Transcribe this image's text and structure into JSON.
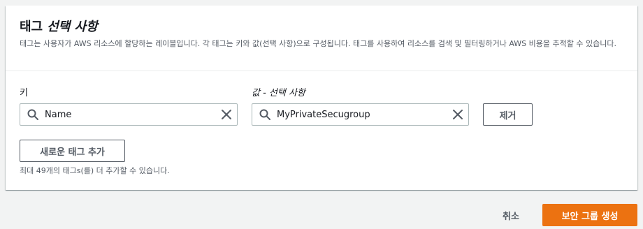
{
  "section": {
    "title": "태그",
    "title_optional": "선택 사항",
    "description": "태그는 사용자가 AWS 리소스에 할당하는 레이블입니다. 각 태그는 키와 값(선택 사항)으로 구성됩니다. 태그를 사용하여 리소스를 검색 및 필터링하거나 AWS 비용을 추적할 수 있습니다."
  },
  "tag_editor": {
    "key_label": "키",
    "value_label": "값 - 선택 사항",
    "rows": [
      {
        "key": "Name",
        "value": "MyPrivateSecugroup",
        "remove_label": "제거"
      }
    ],
    "add_label": "새로운 태그 추가",
    "limit_hint": "최대 49개의 태그s(를) 더 추가할 수 있습니다."
  },
  "footer": {
    "cancel_label": "취소",
    "submit_label": "보안 그룹 생성"
  },
  "colors": {
    "primary": "#ec7211",
    "border": "#aab7b8",
    "text_secondary": "#545b64"
  },
  "icons": {
    "search": "search-icon",
    "clear": "close-icon"
  }
}
